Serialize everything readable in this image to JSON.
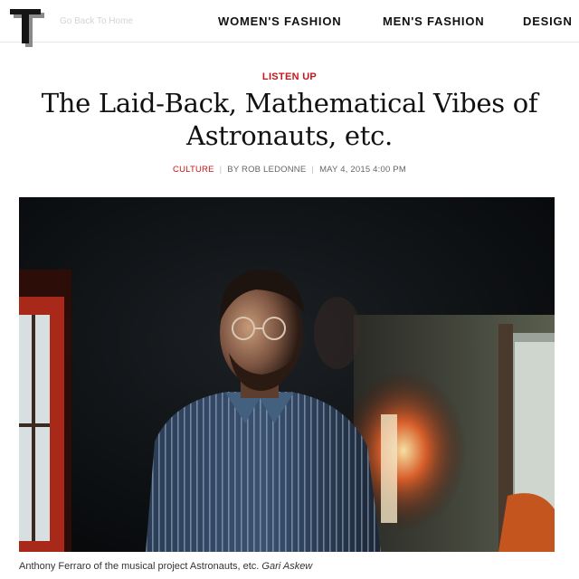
{
  "header": {
    "logo_letter": "T",
    "back_link": "Go Back To Home",
    "nav": [
      {
        "label": "WOMEN'S FASHION"
      },
      {
        "label": "MEN'S FASHION"
      },
      {
        "label": "DESIGN"
      }
    ]
  },
  "article": {
    "kicker": "LISTEN UP",
    "headline": "The Laid-Back, Mathematical Vibes of Astronauts, etc.",
    "category": "CULTURE",
    "byline": "BY ROB LEDONNE",
    "date": "MAY 4, 2015 4:00 PM",
    "photo": {
      "caption": "Anthony Ferraro of the musical project Astronauts, etc.",
      "credit": "Gari Askew"
    }
  },
  "colors": {
    "accent": "#c4161c",
    "nav_text": "#111111",
    "muted": "#666666"
  }
}
